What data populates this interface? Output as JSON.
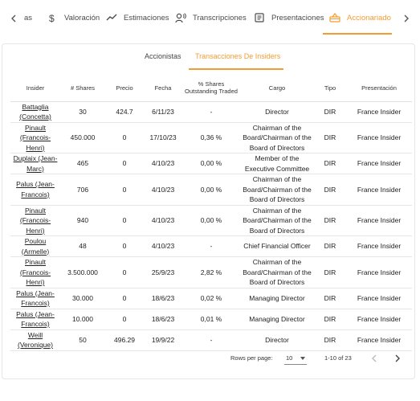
{
  "nav": {
    "partial_tab": "as",
    "tabs": [
      {
        "label": "Valoración",
        "icon": "dollar-icon"
      },
      {
        "label": "Estimaciones",
        "icon": "trend-line-icon"
      },
      {
        "label": "Transcripciones",
        "icon": "voice-icon"
      },
      {
        "label": "Presentaciones",
        "icon": "document-icon"
      },
      {
        "label": "Accionariado",
        "icon": "basket-icon"
      }
    ],
    "active_tab": "Accionariado",
    "accent_color": "#f39c33"
  },
  "subtabs": {
    "items": [
      "Accionistas",
      "Transacciones De Insiders"
    ],
    "active": "Transacciones De Insiders"
  },
  "table": {
    "headers": [
      "Insider",
      "# Shares",
      "Precio",
      "Fecha",
      "% Shares Outstanding Traded",
      "Cargo",
      "Tipo",
      "Presentación"
    ],
    "rows": [
      {
        "insider": "Battaglia (Concetta)",
        "shares": "30",
        "precio": "424.7",
        "fecha": "6/11/23",
        "pct": "-",
        "cargo": "Director",
        "tipo": "DIR",
        "presentacion": "France Insider"
      },
      {
        "insider": "Pinault (Francois-Henri)",
        "shares": "450.000",
        "precio": "0",
        "fecha": "17/10/23",
        "pct": "0,36 %",
        "cargo": "Chairman of the Board/Chairman of the Board of Directors",
        "tipo": "DIR",
        "presentacion": "France Insider"
      },
      {
        "insider": "Duplaix (Jean-Marc)",
        "shares": "465",
        "precio": "0",
        "fecha": "4/10/23",
        "pct": "0,00 %",
        "cargo": "Member of the Executive Committee",
        "tipo": "DIR",
        "presentacion": "France Insider"
      },
      {
        "insider": "Palus (Jean-Francois)",
        "shares": "706",
        "precio": "0",
        "fecha": "4/10/23",
        "pct": "0,00 %",
        "cargo": "Chairman of the Board/Chairman of the Board of Directors",
        "tipo": "DIR",
        "presentacion": "France Insider"
      },
      {
        "insider": "Pinault (Francois-Henri)",
        "shares": "940",
        "precio": "0",
        "fecha": "4/10/23",
        "pct": "0,00 %",
        "cargo": "Chairman of the Board/Chairman of the Board of Directors",
        "tipo": "DIR",
        "presentacion": "France Insider"
      },
      {
        "insider": "Poulou (Armelle)",
        "shares": "48",
        "precio": "0",
        "fecha": "4/10/23",
        "pct": "-",
        "cargo": "Chief Financial Officer",
        "tipo": "DIR",
        "presentacion": "France Insider"
      },
      {
        "insider": "Pinault (Francois-Henri)",
        "shares": "3.500.000",
        "precio": "0",
        "fecha": "25/9/23",
        "pct": "2,82 %",
        "cargo": "Chairman of the Board/Chairman of the Board of Directors",
        "tipo": "DIR",
        "presentacion": "France Insider"
      },
      {
        "insider": "Palus (Jean-Francois)",
        "shares": "30.000",
        "precio": "0",
        "fecha": "18/6/23",
        "pct": "0,02 %",
        "cargo": "Managing Director",
        "tipo": "DIR",
        "presentacion": "France Insider"
      },
      {
        "insider": "Palus (Jean-Francois)",
        "shares": "10.000",
        "precio": "0",
        "fecha": "18/6/23",
        "pct": "0,01 %",
        "cargo": "Managing Director",
        "tipo": "DIR",
        "presentacion": "France Insider"
      },
      {
        "insider": "Weill (Veronique)",
        "shares": "50",
        "precio": "496.29",
        "fecha": "19/9/22",
        "pct": "-",
        "cargo": "Director",
        "tipo": "DIR",
        "presentacion": "France Insider"
      }
    ]
  },
  "pagination": {
    "rows_per_page_label": "Rows per page:",
    "rows_per_page_value": "10",
    "range_label": "1-10 of 23"
  }
}
